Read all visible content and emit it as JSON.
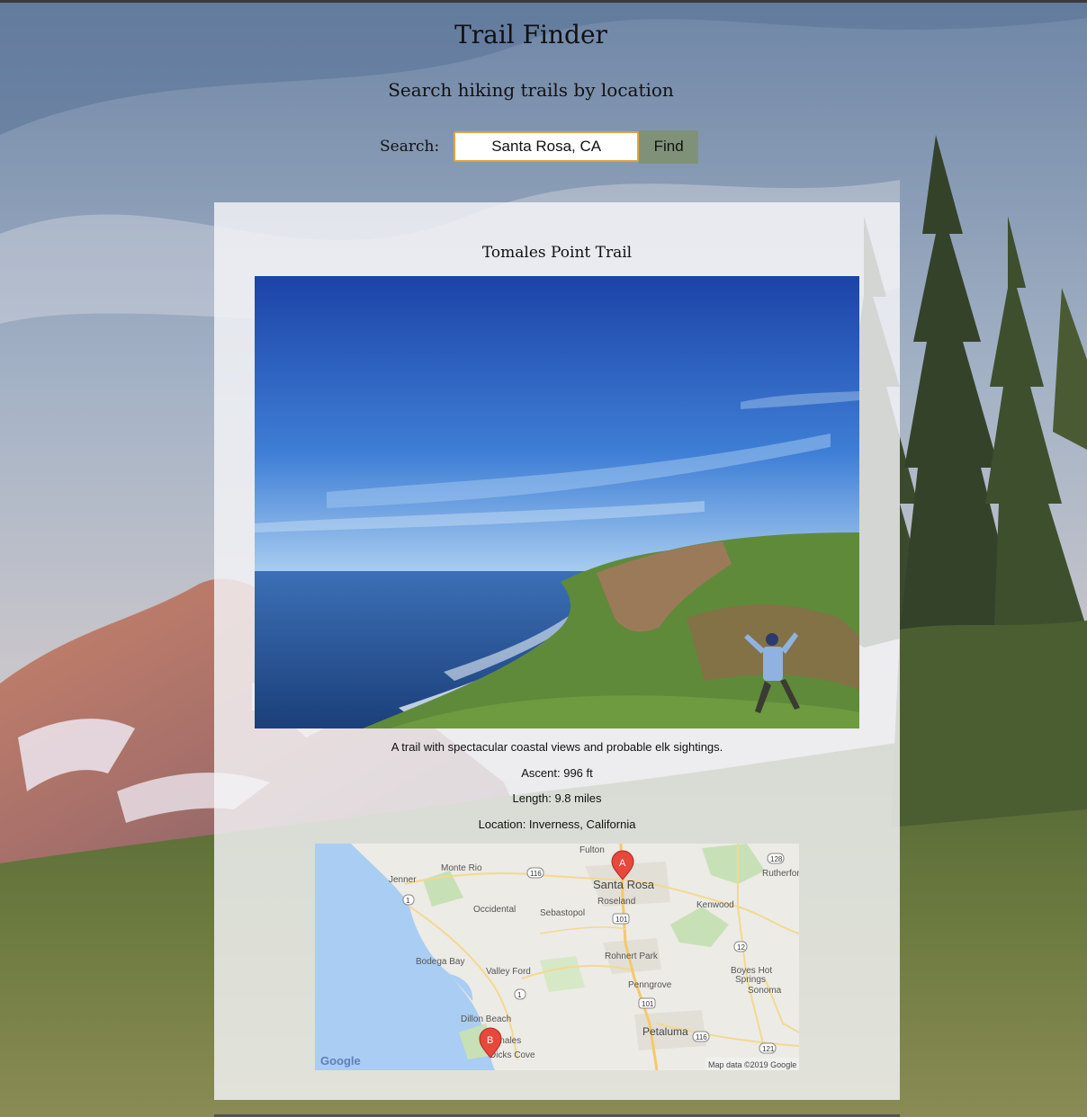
{
  "header": {
    "title": "Trail Finder",
    "subtitle": "Search hiking trails by location"
  },
  "search": {
    "label": "Search:",
    "value": "Santa Rosa, CA",
    "button_label": "Find"
  },
  "trail": {
    "name": "Tomales Point Trail",
    "description": "A trail with spectacular coastal views and probable elk sightings.",
    "ascent": "Ascent: 996 ft",
    "length": "Length: 9.8 miles",
    "location": "Location: Inverness, California"
  },
  "map": {
    "places": [
      "Fulton",
      "Monte Rio",
      "Santa Rosa",
      "Rutherford",
      "Jenner",
      "Roseland",
      "Sebastopol",
      "Kenwood",
      "Occidental",
      "Rohnert Park",
      "Bodega Bay",
      "Valley Ford",
      "Boyes Hot",
      "Springs",
      "Sonoma",
      "Penngrove",
      "Dillon Beach",
      "Petaluma",
      "Tomales",
      "Dicks Cove"
    ],
    "highways": [
      "116",
      "128",
      "1",
      "101",
      "12",
      "1",
      "101",
      "116",
      "121"
    ],
    "marker_a": "A",
    "marker_b": "B",
    "logo": "Google",
    "attribution": "Map data ©2019 Google"
  },
  "colors": {
    "accent_border": "#e3a33a",
    "button_bg": "#7f9279",
    "card_bg": "rgba(245,245,248,0.82)"
  }
}
